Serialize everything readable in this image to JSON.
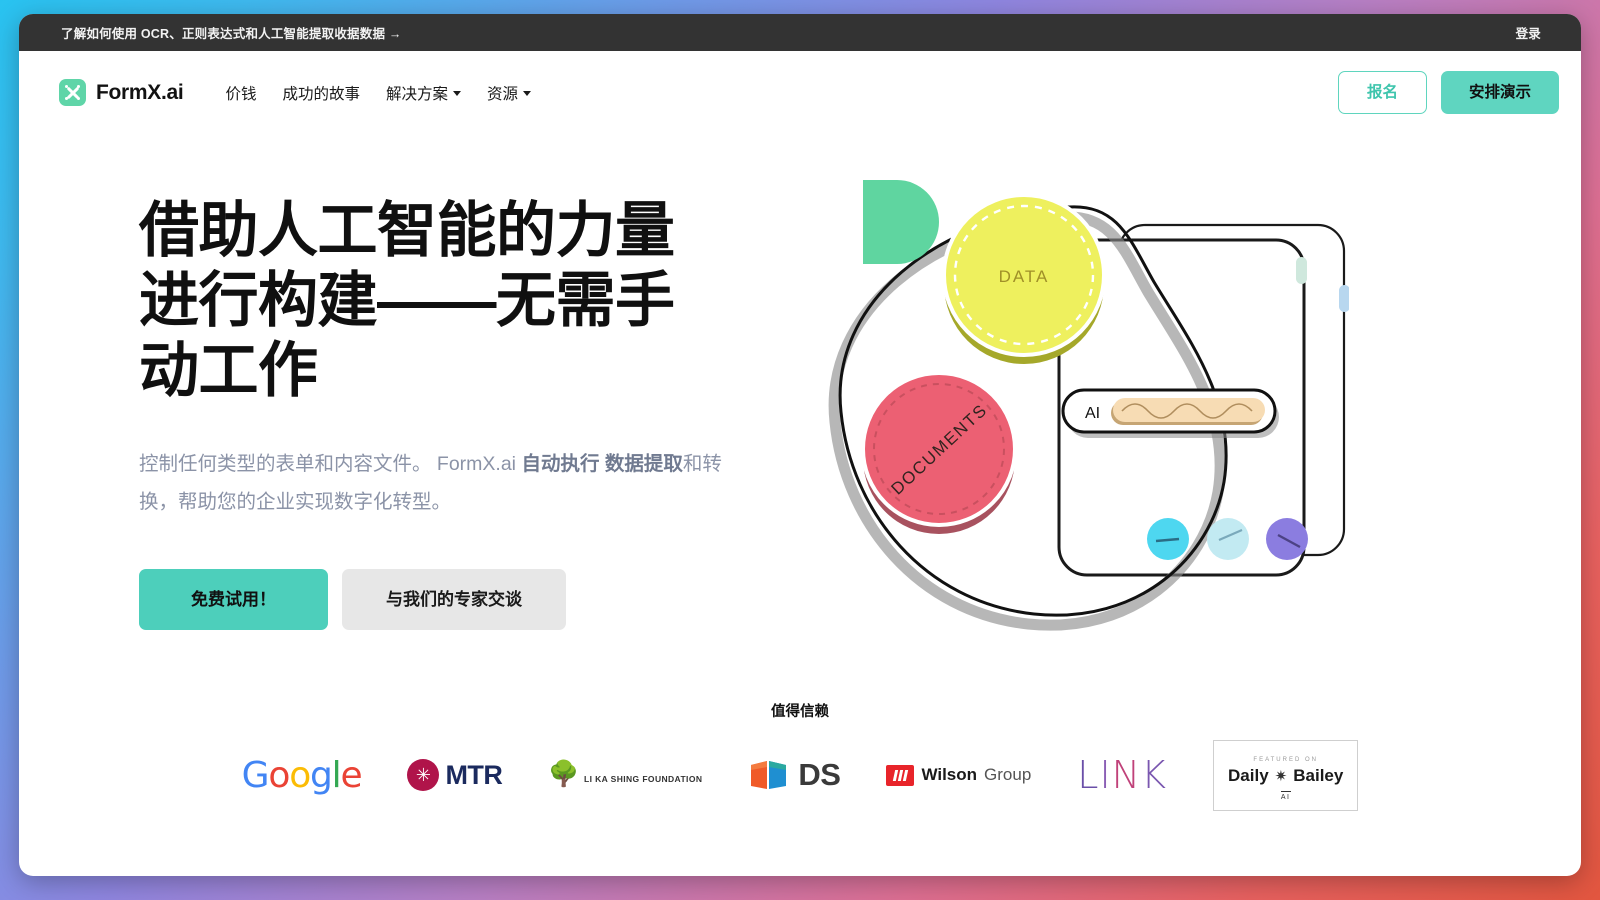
{
  "topbar": {
    "message": "了解如何使用 OCR、正则表达式和人工智能提取收据数据 →",
    "login": "登录"
  },
  "nav": {
    "brand": "FormX.ai",
    "brand_icon": "formx-x-icon",
    "links": [
      {
        "label": "价钱",
        "has_caret": false
      },
      {
        "label": "成功的故事",
        "has_caret": false
      },
      {
        "label": "解决方案",
        "has_caret": true
      },
      {
        "label": "资源",
        "has_caret": true
      }
    ],
    "signup_label": "报名",
    "demo_label": "安排演示"
  },
  "hero": {
    "title_lines": [
      "借助人工智能的力量",
      "进行构建——无需手",
      "动工作"
    ],
    "subtitle_parts": [
      {
        "text": "控制任何类型的表单和内容文件。 FormX.ai ",
        "bold": false
      },
      {
        "text": "自动执行 数据提取",
        "bold": true
      },
      {
        "text": "和转换，帮助您的企业实现数字化转型。",
        "bold": false
      }
    ],
    "cta_primary": "免费试用！",
    "cta_secondary": "与我们的专家交谈"
  },
  "illustration": {
    "data_label": "DATA",
    "documents_label": "DOCUMENTS",
    "ai_label": "AI",
    "colors": {
      "green_shape": "#5fd5a0",
      "data_circle": "#eef05e",
      "data_circle_shade": "#a5a82a",
      "documents_circle": "#ec6073",
      "documents_circle_shade": "#a8525f",
      "ai_bar": "#f7dcb4",
      "ai_bar_shade": "#c6a574",
      "dot_cyan": "#4ed7f0",
      "dot_lightcyan": "#c2eaf2",
      "dot_purple": "#8b7de0",
      "tab_mint": "#cfe8dd",
      "tab_blue": "#b8d7ef"
    }
  },
  "trusted": {
    "label": "值得信赖",
    "logos": [
      {
        "name": "google",
        "text": "Google"
      },
      {
        "name": "mtr",
        "text": "MTR",
        "badge": "✳"
      },
      {
        "name": "li-ka-shing-foundation",
        "text": "LI KA SHING FOUNDATION",
        "glyph": "🌳"
      },
      {
        "name": "ds",
        "text": "DS"
      },
      {
        "name": "wilson-group",
        "text_bold": "Wilson",
        "text_light": "Group"
      },
      {
        "name": "link",
        "text": "LINK"
      },
      {
        "name": "daily-bailey-ai",
        "top": "FEATURED ON",
        "mid_left": "Daily",
        "mid_right": "Bailey",
        "bottom": "AI"
      }
    ]
  },
  "theme": {
    "accent_teal": "#4dcfbb",
    "nav_teal": "#5fd5c0",
    "topbar_bg": "#333333",
    "text_dark": "#101010",
    "text_muted": "#8b93a7"
  }
}
